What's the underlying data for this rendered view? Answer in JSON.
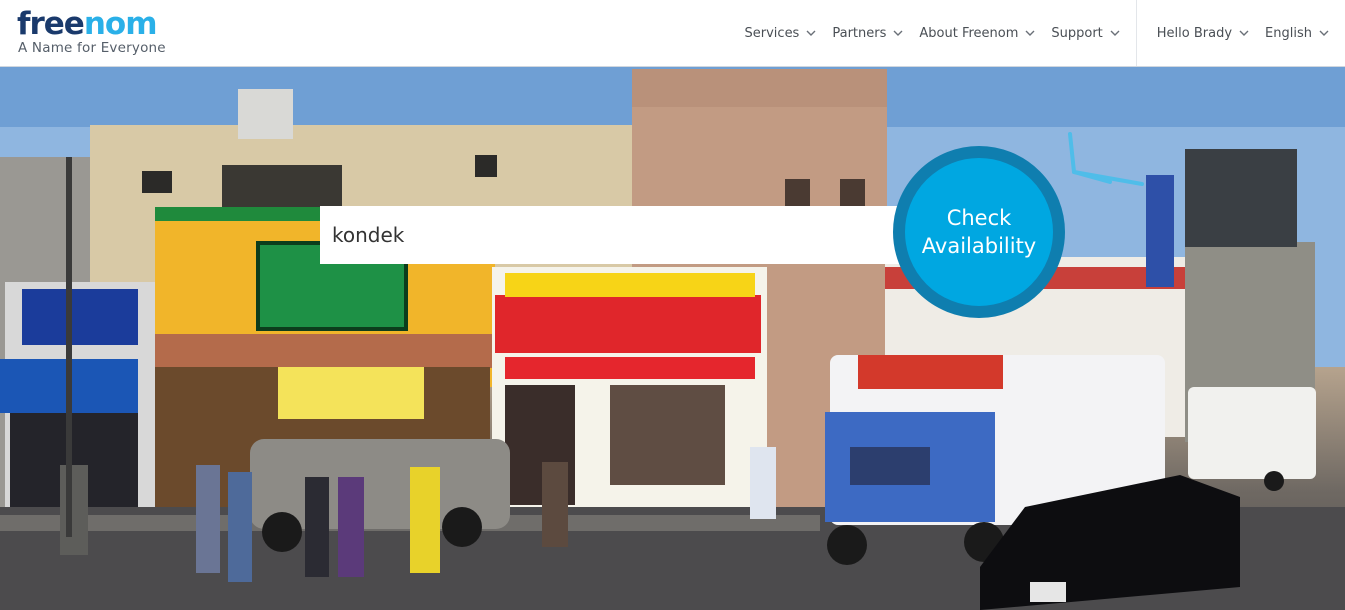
{
  "logo": {
    "word_part1": "free",
    "word_part2": "nom",
    "tagline": "A Name for Everyone"
  },
  "nav": {
    "items": [
      {
        "label": "Services"
      },
      {
        "label": "Partners"
      },
      {
        "label": "About Freenom"
      },
      {
        "label": "Support"
      }
    ],
    "user": {
      "label": "Hello Brady"
    },
    "language": {
      "label": "English"
    }
  },
  "search": {
    "value": "kondek",
    "placeholder": ""
  },
  "check_button": {
    "line1": "Check",
    "line2": "Availability"
  },
  "colors": {
    "brand_dark": "#1a3a6c",
    "brand_light": "#2ab0e8",
    "button": "#00a7e1",
    "button_ring": "#0f7eaf"
  }
}
